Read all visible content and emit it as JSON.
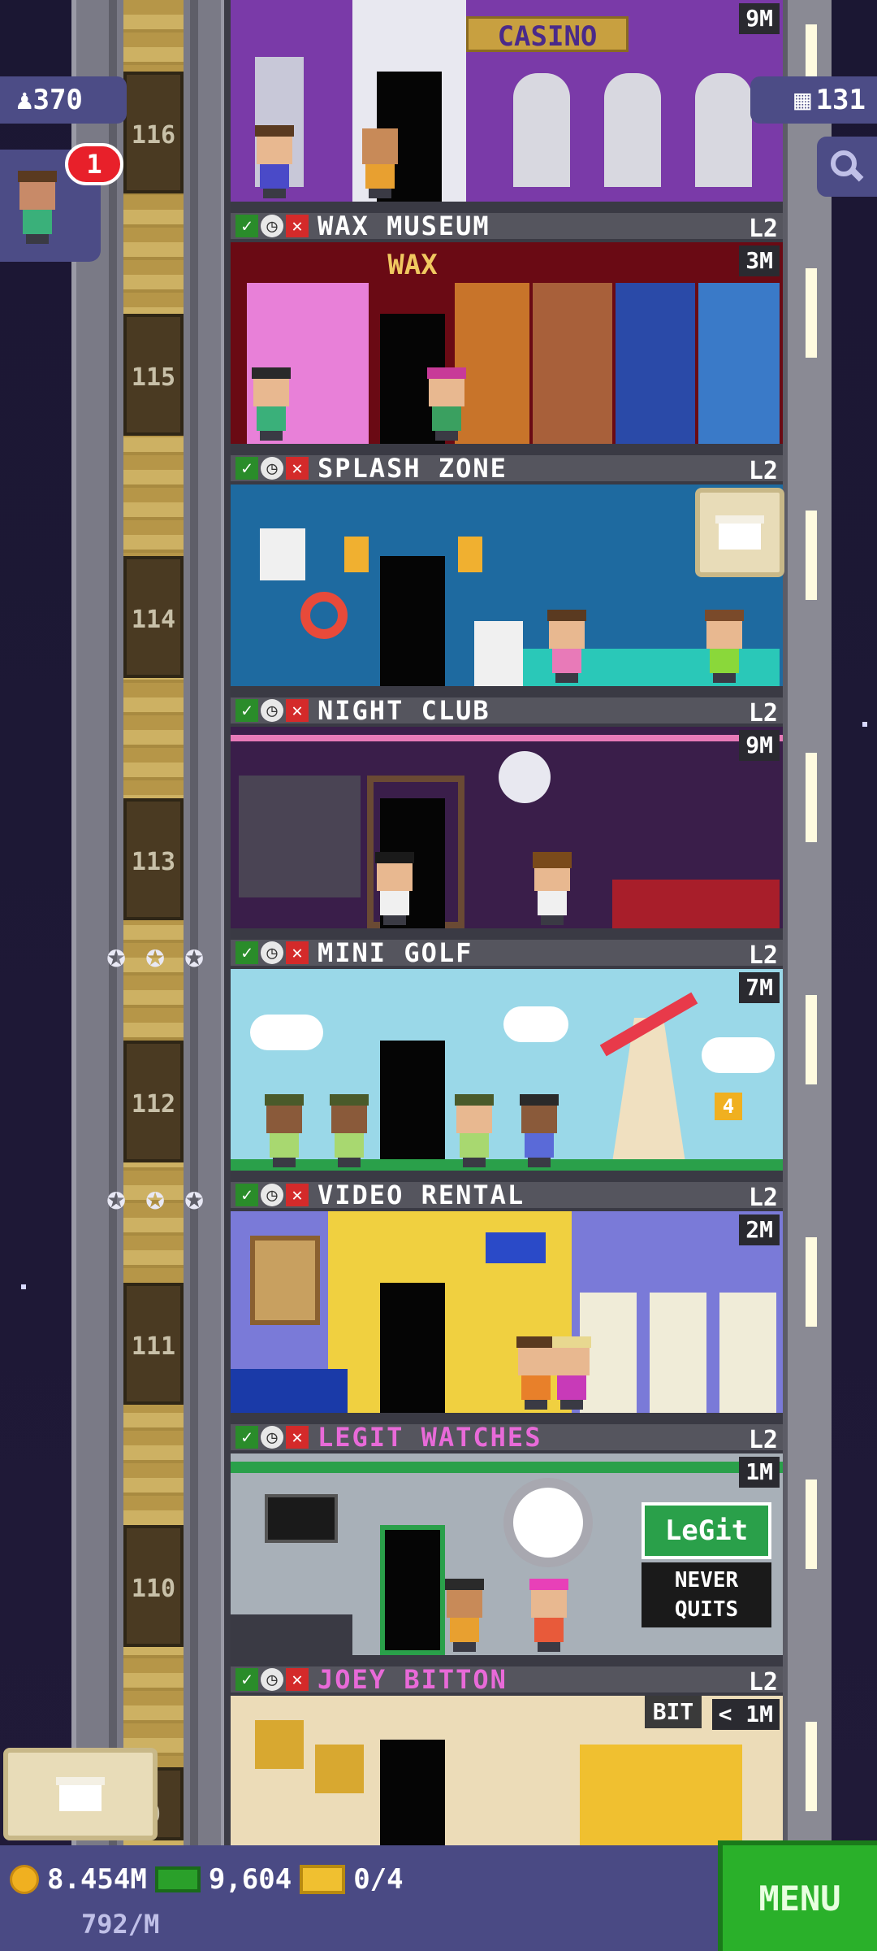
{
  "hud": {
    "population": "370",
    "bux_top": "131",
    "notifications": "1",
    "coins": "8.454M",
    "bux": "9,604",
    "tickets": "0/4",
    "income_rate": "792/M",
    "menu_label": "MENU"
  },
  "icons": {
    "population": "person-icon",
    "bux": "building-icon",
    "search": "magnifier-icon",
    "crate": "crate-icon",
    "coin": "coin-icon",
    "bux_bill": "bux-icon",
    "ticket": "vip-ticket-icon"
  },
  "colors": {
    "hud_bg": "#4a4a84",
    "menu_green": "#2ab02a",
    "stock_ok": "#2a8c2a",
    "stock_out": "#d42a2a",
    "creative_name": "#e86ad8"
  },
  "floors": [
    {
      "number": "116",
      "name": "",
      "level": "",
      "price": "9M",
      "sign": "CASINO"
    },
    {
      "number": "115",
      "name": "WAX MUSEUM",
      "level": "L2",
      "price": "3M",
      "sign": "WAX"
    },
    {
      "number": "114",
      "name": "SPLASH ZONE",
      "level": "L2",
      "price": ""
    },
    {
      "number": "113",
      "name": "NIGHT CLUB",
      "level": "L2",
      "price": "9M"
    },
    {
      "number": "112",
      "name": "MINI GOLF",
      "level": "L2",
      "price": "7M",
      "hole": "4"
    },
    {
      "number": "111",
      "name": "VIDEO RENTAL",
      "level": "L2",
      "price": "2M"
    },
    {
      "number": "110",
      "name": "LEGIT WATCHES",
      "level": "L2",
      "price": "1M",
      "sign_top": "LeGit",
      "sign_bottom": "NEVER QUITS"
    },
    {
      "number": "9",
      "name": "JOEY BITTON",
      "level": "L2",
      "price": "< 1M",
      "sign": "BIT"
    }
  ]
}
